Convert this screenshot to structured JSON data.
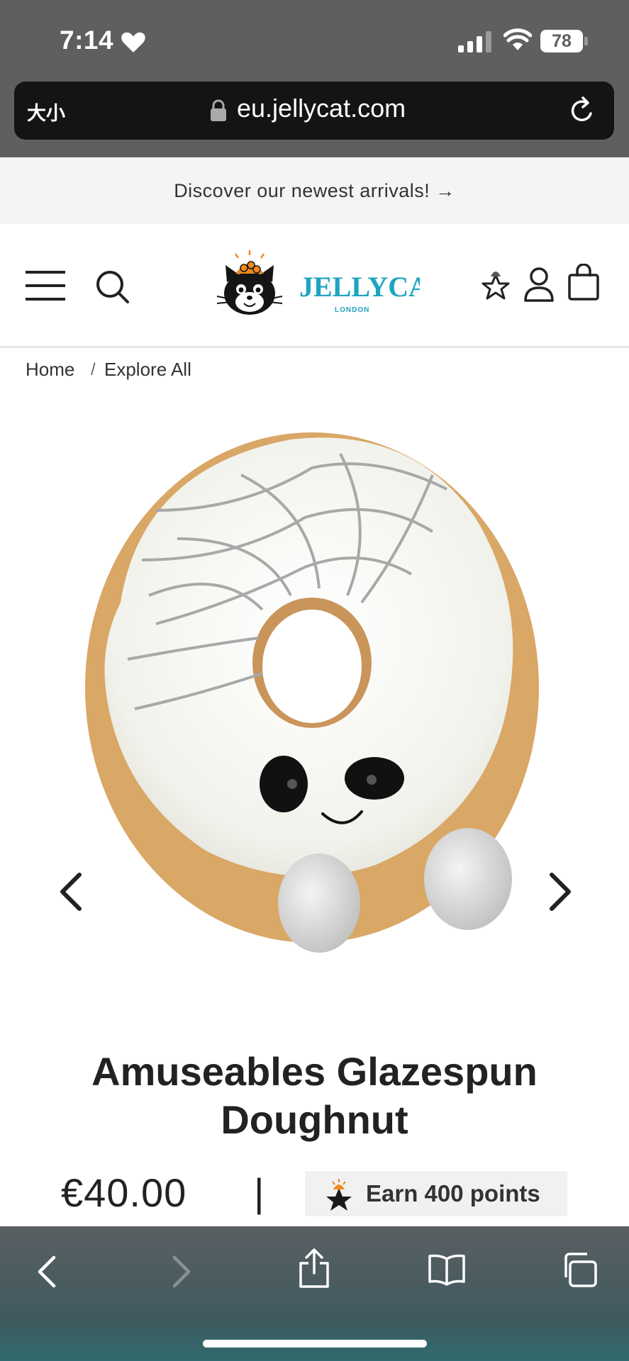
{
  "status_bar": {
    "time": "7:14",
    "battery": "78"
  },
  "browser": {
    "text_size_label": "大小",
    "url": "eu.jellycat.com"
  },
  "promo": {
    "text": "Discover our newest arrivals! →"
  },
  "header": {
    "logo_text": "JELLYCAT",
    "logo_sub": "LONDON"
  },
  "breadcrumb": {
    "home": "Home",
    "separator": "/",
    "current": "Explore All"
  },
  "product": {
    "title": "Amuseables Glazespun Doughnut",
    "price": "€40.00",
    "price_separator": "|",
    "points_label": "Earn 400 points"
  },
  "colors": {
    "accent": "#1fa4bf",
    "status_bg": "#5f5f60",
    "promo_bg": "#f4f4f4"
  }
}
